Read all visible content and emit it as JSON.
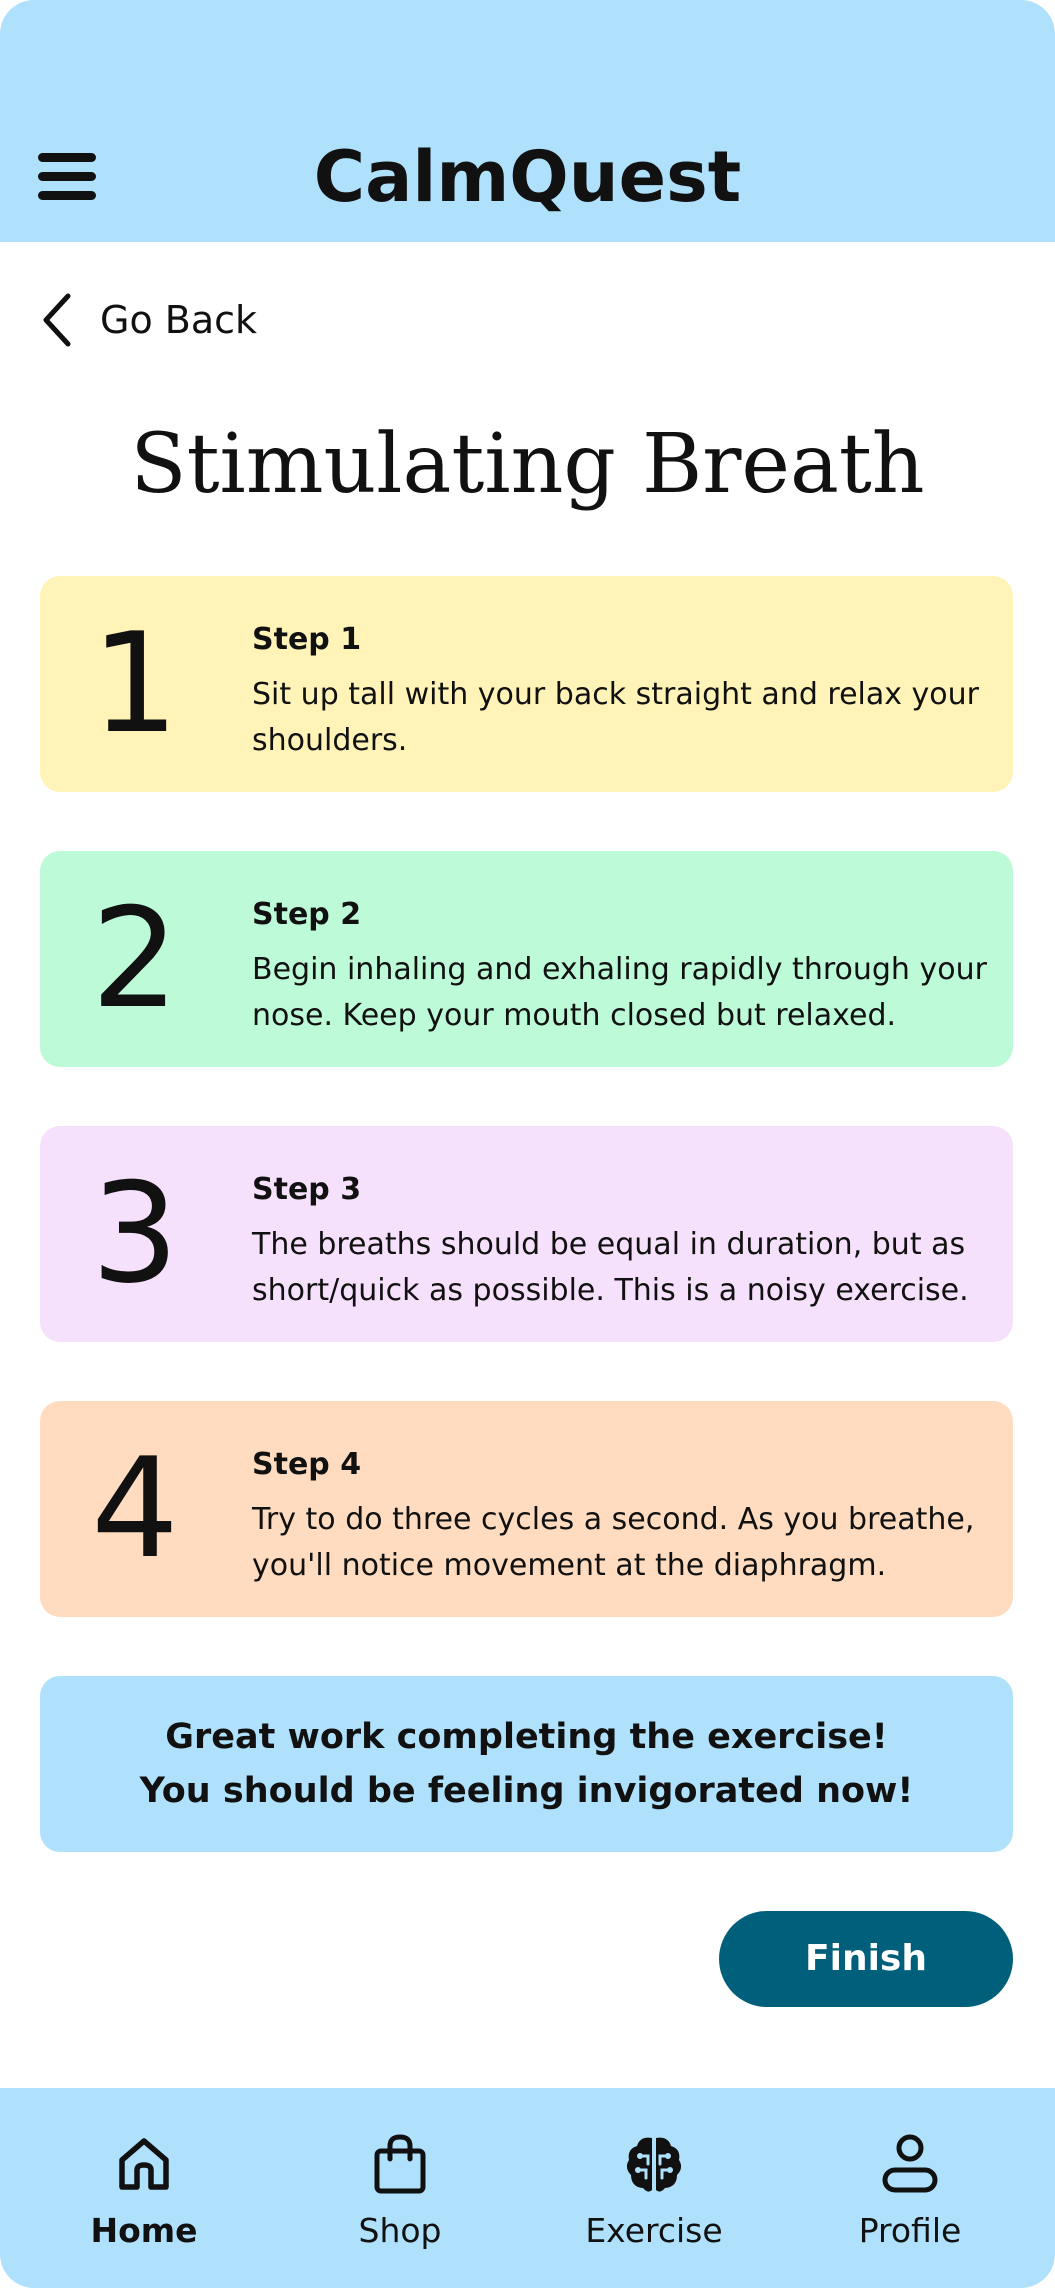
{
  "header": {
    "app_title": "CalmQuest",
    "menu_icon": "hamburger-menu-icon"
  },
  "navigation": {
    "back_label": "Go Back",
    "back_icon": "chevron-left-icon"
  },
  "page_title": "Stimulating Breath",
  "steps": [
    {
      "number": "1",
      "title": "Step 1",
      "text": "Sit up tall with your back straight and relax your shoulders.",
      "color": "#fff3b8"
    },
    {
      "number": "2",
      "title": "Step 2",
      "text": "Begin inhaling and exhaling rapidly through your nose. Keep your mouth closed but relaxed.",
      "color": "#bdfad7"
    },
    {
      "number": "3",
      "title": "Step 3",
      "text": "The breaths should be equal in duration, but as short/quick as possible. This is a noisy exercise.",
      "color": "#f6e1fc"
    },
    {
      "number": "4",
      "title": "Step 4",
      "text": "Try to do three cycles a second. As you breathe, you'll notice movement at the diaphragm.",
      "color": "#ffdcc0"
    }
  ],
  "completion": {
    "line1": "Great work completing the exercise!",
    "line2": "You should be feeling invigorated now!"
  },
  "finish_label": "Finish",
  "bottom_nav": {
    "active": "Home",
    "items": [
      {
        "label": "Home",
        "icon": "home-icon"
      },
      {
        "label": "Shop",
        "icon": "shopping-bag-icon"
      },
      {
        "label": "Exercise",
        "icon": "brain-icon"
      },
      {
        "label": "Profile",
        "icon": "profile-icon"
      }
    ]
  },
  "colors": {
    "header_bg": "#b0e1fc",
    "finish_button": "#005f7a"
  }
}
